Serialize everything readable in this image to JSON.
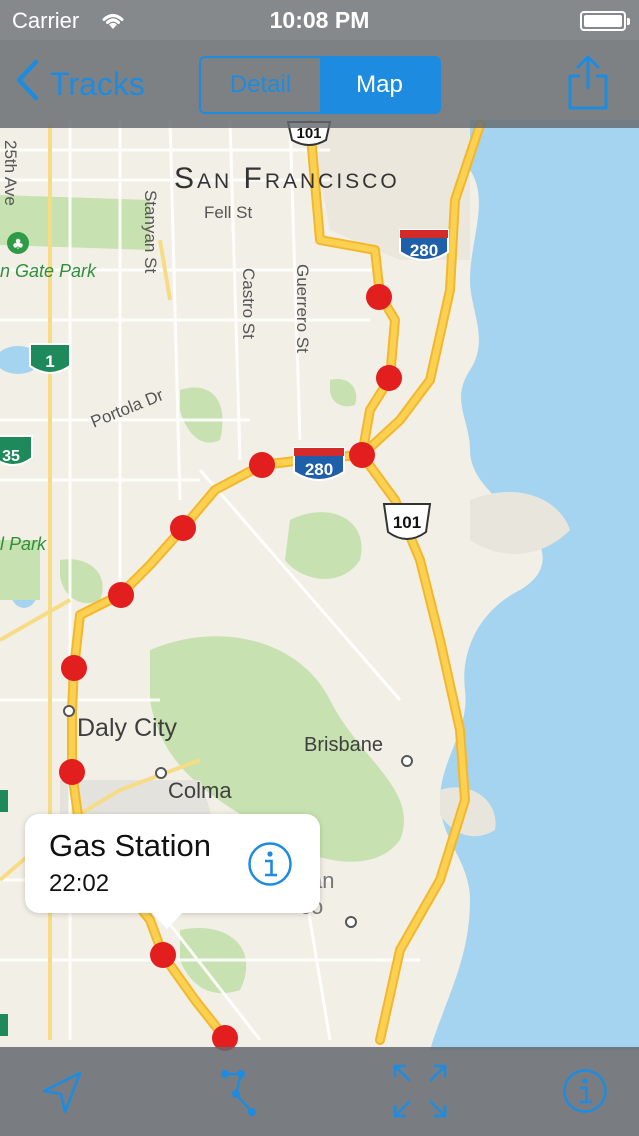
{
  "status_bar": {
    "carrier": "Carrier",
    "time": "10:08 PM",
    "wifi_icon": "wifi-icon",
    "battery_icon": "battery-icon"
  },
  "nav_bar": {
    "back_label": "Tracks",
    "back_icon": "chevron-left-icon",
    "segments": [
      {
        "label": "Detail",
        "selected": false
      },
      {
        "label": "Map",
        "selected": true
      }
    ],
    "share_icon": "share-icon"
  },
  "map": {
    "city_labels": [
      "San Francisco",
      "Daly City",
      "Brisbane",
      "Colma"
    ],
    "street_labels": [
      "Fell St",
      "Stanyan St",
      "Castro St",
      "Guerrero St",
      "Portola Dr",
      "25th Ave"
    ],
    "park_labels": [
      "n Gate Park",
      "l Park"
    ],
    "partial_labels": [
      "an",
      "co"
    ],
    "highway_shields": [
      "101",
      "280",
      "280",
      "101",
      "1",
      "35"
    ],
    "route_color": "#fcc63a",
    "marker_color": "#e21e1e",
    "water_color": "#a5d4f0",
    "park_color": "#c7e2b0",
    "land_color": "#f2efe6"
  },
  "callout": {
    "title": "Gas Station",
    "time": "22:02",
    "info_icon": "info-icon"
  },
  "toolbar": {
    "items": [
      "location-arrow-icon",
      "track-points-icon",
      "expand-icon",
      "info-icon"
    ],
    "accent": "#1d8ce0"
  }
}
